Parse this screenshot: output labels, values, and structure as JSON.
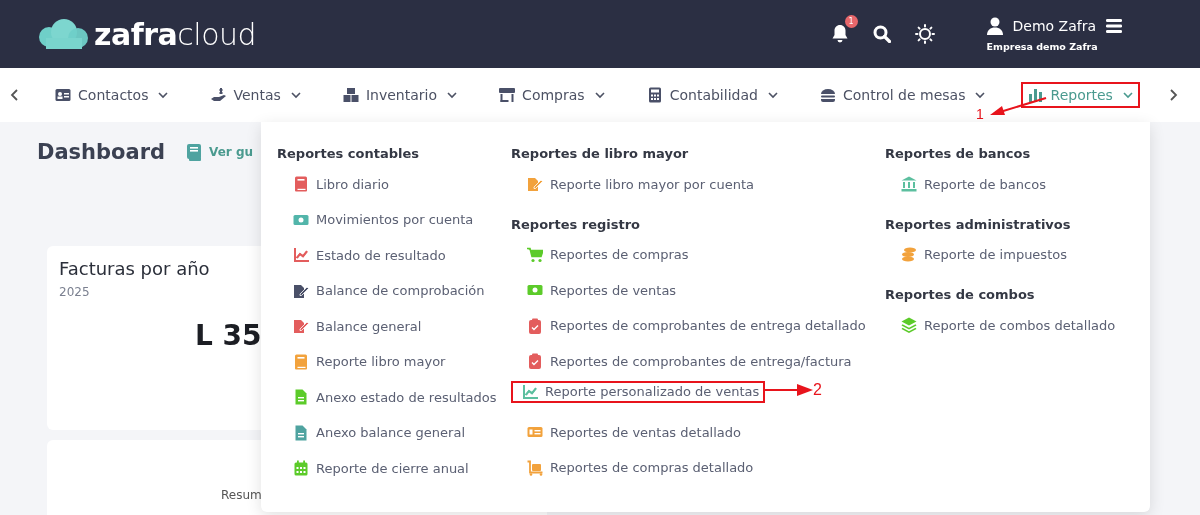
{
  "header": {
    "brand": {
      "bold": "zafra",
      "light": "cloud"
    },
    "notifications": "1",
    "user": {
      "name": "Demo Zafra",
      "company": "Empresa demo Zafra"
    }
  },
  "nav": [
    {
      "label": "Contactos",
      "selected": false,
      "highlighted": false
    },
    {
      "label": "Ventas",
      "selected": false,
      "highlighted": false
    },
    {
      "label": "Inventario",
      "selected": false,
      "highlighted": false
    },
    {
      "label": "Compras",
      "selected": false,
      "highlighted": false
    },
    {
      "label": "Contabilidad",
      "selected": false,
      "highlighted": false
    },
    {
      "label": "Control de mesas",
      "selected": false,
      "highlighted": false
    },
    {
      "label": "Reportes",
      "selected": true,
      "highlighted": true,
      "callout": "1"
    }
  ],
  "page": {
    "title": "Dashboard",
    "guide_link": "Ver gu",
    "cards": [
      {
        "title": "Facturas por año",
        "subtitle": "2025",
        "value": "L 35"
      },
      {
        "text": "Resum"
      }
    ]
  },
  "dropdown": {
    "columns": [
      {
        "sections": [
          {
            "heading": "Reportes contables",
            "items": [
              {
                "label": "Libro diario",
                "color": "#e35d5d",
                "highlighted": false
              },
              {
                "label": "Movimientos por cuenta",
                "color": "#52b5aa",
                "highlighted": false
              },
              {
                "label": "Estado de resultado",
                "color": "#e35d5d",
                "highlighted": false
              },
              {
                "label": "Balance de comprobación",
                "color": "#4a5068",
                "highlighted": false
              },
              {
                "label": "Balance general",
                "color": "#e35d5d",
                "highlighted": false
              },
              {
                "label": "Reporte libro mayor",
                "color": "#f2a23c",
                "highlighted": false
              },
              {
                "label": "Anexo estado de resultados",
                "color": "#5ccb2a",
                "highlighted": false
              },
              {
                "label": "Anexo balance general",
                "color": "#4fa3a0",
                "highlighted": false
              },
              {
                "label": "Reporte de cierre anual",
                "color": "#5ccb2a",
                "highlighted": false
              }
            ]
          }
        ]
      },
      {
        "sections": [
          {
            "heading": "Reportes de libro mayor",
            "items": [
              {
                "label": "Reporte libro mayor por cuenta",
                "color": "#f2a23c",
                "highlighted": false
              }
            ]
          },
          {
            "heading": "Reportes registro",
            "items": [
              {
                "label": "Reportes de compras",
                "color": "#5ccb2a",
                "highlighted": false
              },
              {
                "label": "Reportes de ventas",
                "color": "#5ccb2a",
                "highlighted": false
              },
              {
                "label": "Reportes de comprobantes de entrega detallado",
                "color": "#e35d5d",
                "highlighted": false
              },
              {
                "label": "Reportes de comprobantes de entrega/factura",
                "color": "#e35d5d",
                "highlighted": false
              },
              {
                "label": "Reporte personalizado de ventas",
                "color": "#5cbf9f",
                "highlighted": true,
                "callout": "2"
              },
              {
                "label": "Reportes de ventas detallado",
                "color": "#f2a23c",
                "highlighted": false
              },
              {
                "label": "Reportes de compras detallado",
                "color": "#f2a23c",
                "highlighted": false
              }
            ]
          }
        ]
      },
      {
        "sections": [
          {
            "heading": "Reportes de bancos",
            "items": [
              {
                "label": "Reporte de bancos",
                "color": "#5cbf9f",
                "highlighted": false
              }
            ]
          },
          {
            "heading": "Reportes administrativos",
            "items": [
              {
                "label": "Reporte de impuestos",
                "color": "#f2a23c",
                "highlighted": false
              }
            ]
          },
          {
            "heading": "Reportes de combos",
            "items": [
              {
                "label": "Reporte de combos detallado",
                "color": "#5ccb2a",
                "highlighted": false
              }
            ]
          }
        ]
      }
    ]
  }
}
